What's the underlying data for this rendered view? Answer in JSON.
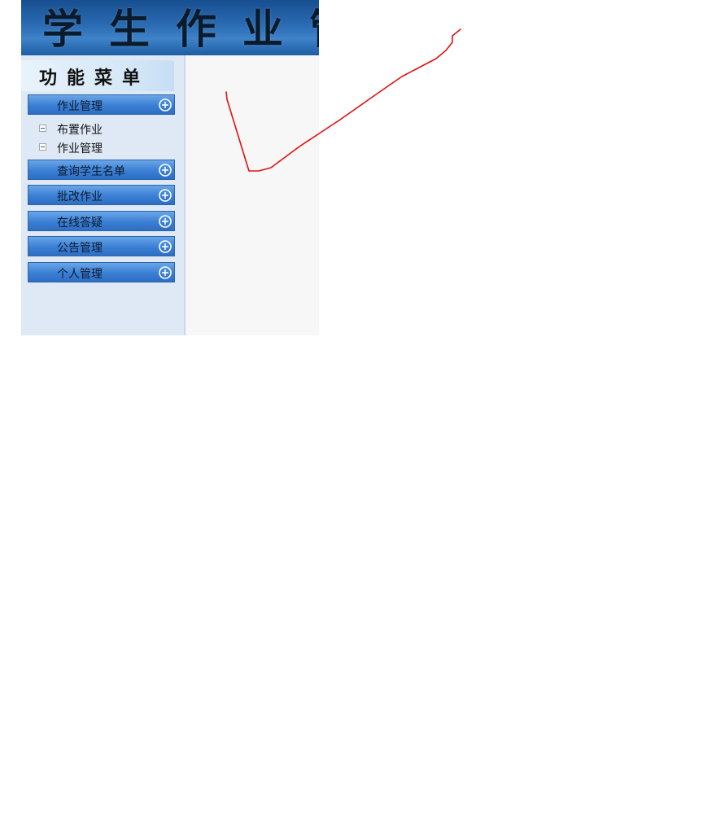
{
  "banner": {
    "title": "学生作业管"
  },
  "sidebar": {
    "header": "功能菜单",
    "menus": [
      {
        "label": "作业管理",
        "expanded": true,
        "children": [
          {
            "label": "布置作业"
          },
          {
            "label": "作业管理"
          }
        ]
      },
      {
        "label": "查询学生名单"
      },
      {
        "label": "批改作业"
      },
      {
        "label": "在线答疑"
      },
      {
        "label": "公告管理"
      },
      {
        "label": "个人管理"
      }
    ]
  },
  "colors": {
    "banner_blue": "#2a6bb3",
    "menu_bar_blue": "#3a7fd4",
    "sidebar_bg": "#dfe9f6",
    "content_bg": "#f7f7f7",
    "annotation_red": "#e01010"
  },
  "icons": {
    "menu_expand": "plus-circle-icon",
    "sub_item": "minus-box-icon"
  }
}
